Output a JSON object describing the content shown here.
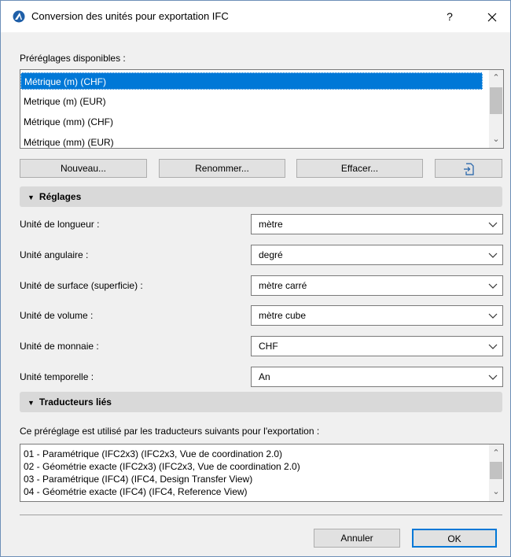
{
  "window": {
    "title": "Conversion des unités pour exportation IFC",
    "help_label": "?",
    "close_label": "✕"
  },
  "presets": {
    "label": "Préréglages disponibles :",
    "items": [
      "Métrique (m) (CHF)",
      "Metrique (m) (EUR)",
      "Métrique (mm) (CHF)",
      "Métrique (mm) (EUR)"
    ],
    "selected_index": 0
  },
  "preset_buttons": {
    "new": "Nouveau...",
    "rename": "Renommer...",
    "delete": "Effacer...",
    "import_icon": "import-icon"
  },
  "settings": {
    "header": "Réglages",
    "rows": [
      {
        "label": "Unité de longueur :",
        "value": "mètre"
      },
      {
        "label": "Unité angulaire :",
        "value": "degré"
      },
      {
        "label": "Unité de surface (superficie) :",
        "value": "mètre carré"
      },
      {
        "label": "Unité de volume :",
        "value": "mètre cube"
      },
      {
        "label": "Unité de monnaie :",
        "value": "CHF"
      },
      {
        "label": "Unité temporelle :",
        "value": "An"
      }
    ]
  },
  "translators": {
    "header": "Traducteurs liés",
    "description": "Ce préréglage est utilisé par les traducteurs suivants pour l'exportation :",
    "items": [
      "01 - Paramétrique (IFC2x3) (IFC2x3, Vue de coordination 2.0)",
      "02 - Géométrie exacte (IFC2x3) (IFC2x3, Vue de coordination 2.0)",
      "03 - Paramétrique (IFC4) (IFC4, Design Transfer View)",
      "04 - Géométrie exacte (IFC4) (IFC4, Reference View)"
    ]
  },
  "footer": {
    "cancel": "Annuler",
    "ok": "OK"
  },
  "colors": {
    "selection": "#0078d7",
    "section_header": "#d9d9d9",
    "dialog_bg": "#f0f0f0"
  }
}
